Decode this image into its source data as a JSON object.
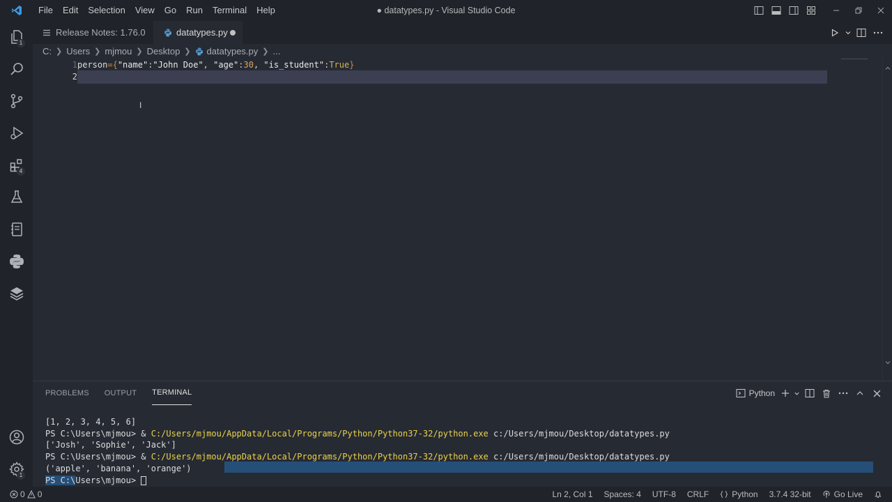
{
  "titlebar": {
    "menu": [
      "File",
      "Edit",
      "Selection",
      "View",
      "Go",
      "Run",
      "Terminal",
      "Help"
    ],
    "window_title": "● datatypes.py - Visual Studio Code"
  },
  "activitybar": {
    "items": [
      {
        "icon": "explorer-icon",
        "badge": "1"
      },
      {
        "icon": "search-icon"
      },
      {
        "icon": "source-control-icon"
      },
      {
        "icon": "run-debug-icon"
      },
      {
        "icon": "extensions-icon",
        "badge": "4"
      },
      {
        "icon": "testing-icon"
      },
      {
        "icon": "notebook-icon"
      },
      {
        "icon": "python-icon"
      },
      {
        "icon": "layers-icon"
      }
    ],
    "bottom": [
      {
        "icon": "account-icon"
      },
      {
        "icon": "manage-gear-icon",
        "badge": "1"
      }
    ]
  },
  "tabs": [
    {
      "label": "Release Notes: 1.76.0",
      "active": false
    },
    {
      "label": "datatypes.py",
      "active": true,
      "modified": true
    }
  ],
  "breadcrumb": [
    "C:",
    "Users",
    "mjmou",
    "Desktop",
    "datatypes.py",
    "..."
  ],
  "editor": {
    "line_numbers": [
      "1",
      "2"
    ],
    "line1_tokens": [
      {
        "text": "person",
        "cls": "t-var"
      },
      {
        "text": "=",
        "cls": "t-op"
      },
      {
        "text": "{",
        "cls": "t-op"
      },
      {
        "text": "\"name\"",
        "cls": "t-str"
      },
      {
        "text": ":",
        "cls": "t-punc"
      },
      {
        "text": "\"John Doe\"",
        "cls": "t-str"
      },
      {
        "text": ", ",
        "cls": "t-punc"
      },
      {
        "text": "\"age\"",
        "cls": "t-str"
      },
      {
        "text": ":",
        "cls": "t-punc"
      },
      {
        "text": "30",
        "cls": "t-num"
      },
      {
        "text": ", ",
        "cls": "t-punc"
      },
      {
        "text": "\"is_student\"",
        "cls": "t-str"
      },
      {
        "text": ":",
        "cls": "t-punc"
      },
      {
        "text": "True",
        "cls": "t-kw"
      },
      {
        "text": "}",
        "cls": "t-op"
      }
    ]
  },
  "panel": {
    "tabs": [
      "PROBLEMS",
      "OUTPUT",
      "TERMINAL"
    ],
    "active_tab": "TERMINAL",
    "shell_label": "Python",
    "terminal": {
      "line1": "[1, 2, 3, 4, 5, 6]",
      "prompt": "PS C:\\Users\\mjmou> ",
      "amp": "& ",
      "python_path": "C:/Users/mjmou/AppData/Local/Programs/Python/Python37-32/python.exe",
      "script_path": " c:/Users/mjmou/Desktop/datatypes.py",
      "line3": "['Josh', 'Sophie', 'Jack']",
      "line5": "('apple', 'banana', 'orange')",
      "final_prompt_sel": "PS C:\\",
      "final_prompt_rest": "Users\\mjmou> "
    }
  },
  "statusbar": {
    "errors": "0",
    "warnings": "0",
    "position": "Ln 2, Col 1",
    "spaces": "Spaces: 4",
    "encoding": "UTF-8",
    "eol": "CRLF",
    "language": "Python",
    "interpreter": "3.7.4 32-bit",
    "golive": "Go Live"
  }
}
